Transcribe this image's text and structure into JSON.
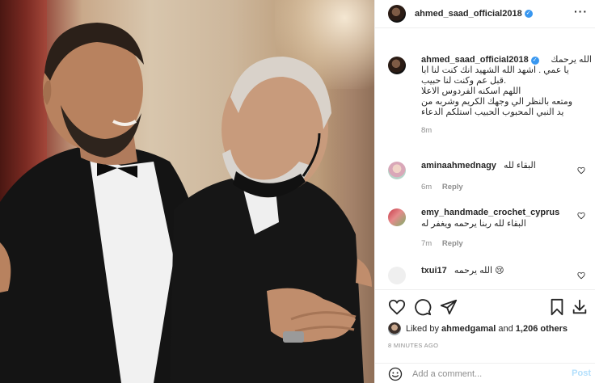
{
  "post": {
    "username": "ahmed_saad_official2018",
    "verified": true,
    "more_icon": "more-horizontal-icon"
  },
  "caption": {
    "username": "ahmed_saad_official2018",
    "first_line_text": "الله يرحمك",
    "lines": [
      "يا عمي . اشهد الله الشهيد انك كنت لنا ابا",
      ".قبل عم وكنت لنا حبيب",
      "اللهم اسكنه الفردوس الاعلا",
      "ومتعه بالنظر الي وجهك الكريم وشربه من",
      "يد النبي المحبوب الحبيب استلكم الدعاء"
    ],
    "time": "8m"
  },
  "comments": [
    {
      "username": "aminaahmednagy",
      "text": "البقاء لله",
      "time": "6m",
      "reply_label": "Reply"
    },
    {
      "username": "emy_handmade_crochet_cyprus",
      "text": "البقاء لله ربنا يرحمه ويغفر له",
      "time": "7m",
      "reply_label": "Reply"
    },
    {
      "username": "txui17",
      "text": "الله يرحمه 😢"
    }
  ],
  "actions": {
    "icons": [
      "heart-icon",
      "comment-icon",
      "share-icon",
      "bookmark-icon",
      "download-icon"
    ],
    "liked_by_prefix": "Liked by",
    "liked_by_user": "ahmedgamal",
    "liked_by_and": "and",
    "others": "1,206 others",
    "timestamp": "8 MINUTES AGO"
  },
  "composer": {
    "placeholder": "Add a comment...",
    "post_label": "Post",
    "emoji_icon": "smile-icon"
  },
  "colors": {
    "verified": "#3897f0",
    "post_button": "#b2dffc",
    "meta_text": "#8e8e8e"
  }
}
